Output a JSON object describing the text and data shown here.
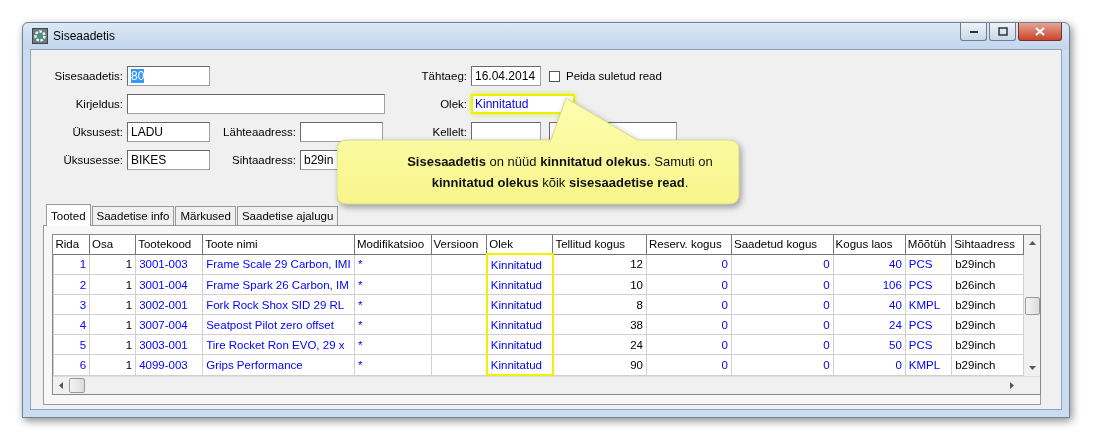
{
  "window": {
    "title": "Siseaadetis"
  },
  "form": {
    "left": [
      {
        "label": "Sisesaadetis:",
        "value": "80",
        "text_selected": true
      },
      {
        "label": "Kirjeldus:",
        "text_selected": false
      },
      {
        "label": "Üksusest:",
        "value": "LADU",
        "text_selected": false
      },
      {
        "label": "Üksusesse:",
        "value": "BIKES",
        "text_selected": false
      }
    ],
    "middle": [
      {
        "label": "Lähteaadress:",
        "text_selected": false
      },
      {
        "label": "Sihtaadress:",
        "value": "b29in",
        "text_selected": false
      }
    ],
    "right": [
      {
        "label": "Tähtaeg:",
        "value": "16.04.2014",
        "kind": "single",
        "highlighted": false
      },
      {
        "label": "Olek:",
        "value": "Kinnitatud",
        "kind": "status",
        "highlighted": true
      },
      {
        "label": "Kellelt:",
        "kind": "pair",
        "highlighted": false
      }
    ],
    "hide_closed": {
      "label": "Peida suletud read",
      "checked": false
    }
  },
  "callout": {
    "text": "**Sisesaadetis** on nüüd **kinnitatud olekus**. Samuti on **kinnitatud olekus** kõik **sisesaadetise read**."
  },
  "tabs": [
    {
      "label": "Tooted",
      "selected": true
    },
    {
      "label": "Saadetise info",
      "selected": false
    },
    {
      "label": "Märkused",
      "selected": false
    },
    {
      "label": "Saadetise ajalugu",
      "selected": false
    }
  ],
  "table": {
    "columns": [
      {
        "label": "Rida",
        "linked": true,
        "highlighted": false
      },
      {
        "label": "Osa",
        "linked": false,
        "highlighted": false
      },
      {
        "label": "Tootekood",
        "linked": true,
        "highlighted": false
      },
      {
        "label": "Toote nimi",
        "linked": true,
        "highlighted": false
      },
      {
        "label": "Modifikatsioo",
        "linked": true,
        "highlighted": false
      },
      {
        "label": "Versioon",
        "highlighted": false
      },
      {
        "label": "Olek",
        "linked": true,
        "highlighted": true
      },
      {
        "label": "Tellitud kogus",
        "linked": false,
        "highlighted": false
      },
      {
        "label": "Reserv. kogus",
        "linked": true,
        "highlighted": false
      },
      {
        "label": "Saadetud kogus",
        "linked": true,
        "highlighted": false
      },
      {
        "label": "Kogus laos",
        "linked": true,
        "highlighted": false
      },
      {
        "label": "Mõõtüh",
        "linked": true,
        "highlighted": false
      },
      {
        "label": "Sihtaadress",
        "linked": false,
        "highlighted": false
      }
    ],
    "rows": [
      [
        "1",
        "1",
        "3001-003",
        "Frame Scale 29 Carbon, IMI",
        "*",
        null,
        "Kinnitatud",
        "12",
        "0",
        "0",
        "40",
        "PCS",
        "b29inch"
      ],
      [
        "2",
        "1",
        "3001-004",
        "Frame Spark 26 Carbon, IM",
        "*",
        null,
        "Kinnitatud",
        "10",
        "0",
        "0",
        "106",
        "PCS",
        "b26inch"
      ],
      [
        "3",
        "1",
        "3002-001",
        "Fork Rock Shox SID 29 RL",
        "*",
        null,
        "Kinnitatud",
        "8",
        "0",
        "0",
        "40",
        "KMPL",
        "b29inch"
      ],
      [
        "4",
        "1",
        "3007-004",
        "Seatpost Pilot zero offset",
        "*",
        null,
        "Kinnitatud",
        "38",
        "0",
        "0",
        "24",
        "PCS",
        "b29inch"
      ],
      [
        "5",
        "1",
        "3003-001",
        "Tire Rocket Ron EVO, 29 x",
        "*",
        null,
        "Kinnitatud",
        "24",
        "0",
        "0",
        "50",
        "PCS",
        "b29inch"
      ],
      [
        "6",
        "1",
        "4099-003",
        "Grips Performance",
        "*",
        null,
        "Kinnitatud",
        "90",
        "0",
        "0",
        "0",
        "KMPL",
        "b29inch"
      ]
    ]
  }
}
